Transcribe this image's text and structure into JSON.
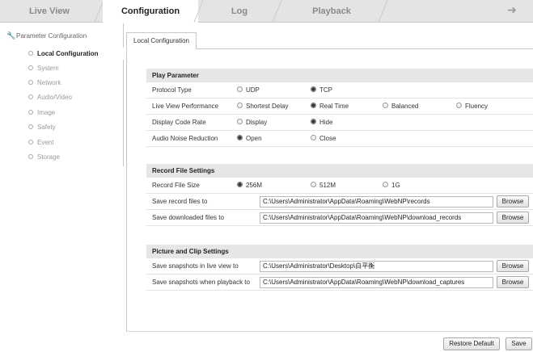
{
  "top_tabs": [
    {
      "label": "Live View"
    },
    {
      "label": "Configuration"
    },
    {
      "label": "Log"
    },
    {
      "label": "Playback"
    }
  ],
  "sidebar": {
    "title": "Parameter Configuration",
    "items": [
      {
        "label": "Local Configuration"
      },
      {
        "label": "System"
      },
      {
        "label": "Network"
      },
      {
        "label": "Audio/Video"
      },
      {
        "label": "Image"
      },
      {
        "label": "Safety"
      },
      {
        "label": "Event"
      },
      {
        "label": "Storage"
      }
    ]
  },
  "subtab": {
    "label": "Local Configuration"
  },
  "play": {
    "title": "Play Parameter",
    "protocol": {
      "label": "Protocol Type",
      "opt1": "UDP",
      "opt2": "TCP"
    },
    "performance": {
      "label": "Live View Performance",
      "opt1": "Shortest Delay",
      "opt2": "Real Time",
      "opt3": "Balanced",
      "opt4": "Fluency"
    },
    "coderate": {
      "label": "Display Code Rate",
      "opt1": "Display",
      "opt2": "Hide"
    },
    "noise": {
      "label": "Audio Noise Reduction",
      "opt1": "Open",
      "opt2": "Close"
    }
  },
  "record": {
    "title": "Record File Settings",
    "size": {
      "label": "Record File Size",
      "opt1": "256M",
      "opt2": "512M",
      "opt3": "1G"
    },
    "save_record": {
      "label": "Save record files to",
      "path": "C:\\Users\\Administrator\\AppData\\Roaming\\WebNP\\records"
    },
    "save_download": {
      "label": "Save downloaded files to",
      "path": "C:\\Users\\Administrator\\AppData\\Roaming\\WebNP\\download_records"
    }
  },
  "picture": {
    "title": "Picture and Clip Settings",
    "snap_live": {
      "label": "Save snapshots in live view to",
      "path": "C:\\Users\\Administrator\\Desktop\\白平衡"
    },
    "snap_playback": {
      "label": "Save snapshots when playback to",
      "path": "C:\\Users\\Administrator\\AppData\\Roaming\\WebNP\\download_captures"
    }
  },
  "buttons": {
    "browse": "Browse",
    "restore": "Restore Default",
    "save": "Save"
  }
}
